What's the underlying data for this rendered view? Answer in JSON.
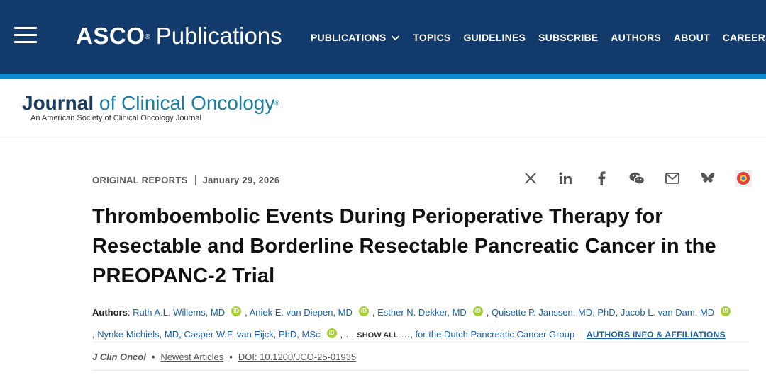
{
  "site": {
    "brand_bold": "ASCO",
    "brand_reg": "®",
    "brand_light": "Publications",
    "nav": [
      {
        "label": "PUBLICATIONS",
        "dropdown": true
      },
      {
        "label": "TOPICS",
        "dropdown": false
      },
      {
        "label": "GUIDELINES",
        "dropdown": false
      },
      {
        "label": "SUBSCRIBE",
        "dropdown": false
      },
      {
        "label": "AUTHORS",
        "dropdown": false
      },
      {
        "label": "ABOUT",
        "dropdown": false
      },
      {
        "label": "CAREERS",
        "dropdown": true
      }
    ],
    "colors": {
      "header_bg": "#123a6b",
      "stripe": "#0b8ad0",
      "link": "#1a5fa8",
      "orcid": "#a6ce39"
    }
  },
  "journal": {
    "title_bold": "Journal",
    "title_rest": " of Clinical Oncology",
    "reg": "®",
    "subtitle": "An American Society of Clinical Oncology Journal"
  },
  "article": {
    "type": "ORIGINAL REPORTS",
    "date": "January 29, 2026",
    "title": "Thromboembolic Events During Perioperative Therapy for Resectable and Borderline Resectable Pancreatic Cancer in the PREOPANC-2 Trial",
    "authors_label": "Authors",
    "authors": [
      "Ruth A.L. Willems, MD",
      "Aniek E. van Diepen, MD",
      "Esther N. Dekker, MD",
      "Quisette P. Janssen, MD, PhD",
      "Jacob L. van Dam, MD",
      "Nynke Michiels, MD",
      "Casper W.F. van Eijck, PhD, MSc"
    ],
    "orcid_label": "iD",
    "ellipsis": "…",
    "show_all": "SHOW ALL",
    "group": "for the Dutch Pancreatic Cancer Group",
    "affiliations": "AUTHORS INFO & AFFILIATIONS",
    "journal_abbrev": "J Clin Oncol",
    "newest": "Newest Articles",
    "doi": "DOI: 10.1200/JCO-25-01935"
  },
  "share_icons": [
    "x-icon",
    "linkedin-icon",
    "facebook-icon",
    "wechat-icon",
    "email-icon",
    "bluesky-icon",
    "altmetric-icon"
  ]
}
